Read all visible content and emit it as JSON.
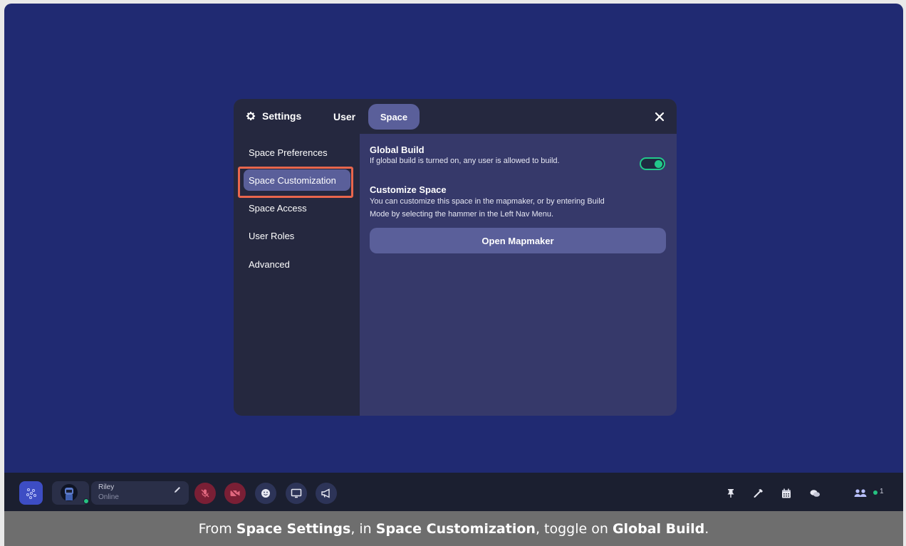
{
  "modal": {
    "title": "Settings",
    "tabs": [
      {
        "label": "User"
      },
      {
        "label": "Space"
      }
    ],
    "sidebar": [
      {
        "label": "Space Preferences"
      },
      {
        "label": "Space Customization"
      },
      {
        "label": "Space Access"
      },
      {
        "label": "User Roles"
      },
      {
        "label": "Advanced"
      }
    ],
    "global_build": {
      "title": "Global Build",
      "description": "If global build is turned on, any user is allowed to build.",
      "enabled": true
    },
    "customize": {
      "title": "Customize Space",
      "description_line1": "You can customize this space in the mapmaker, or by entering Build",
      "description_line2": "Mode by selecting the hammer in the Left Nav Menu.",
      "button_label": "Open Mapmaker"
    }
  },
  "bottombar": {
    "user_name": "Riley",
    "user_status": "Online",
    "participant_count": "1"
  },
  "caption": {
    "part1": "From ",
    "bold1": "Space Settings",
    "part2": ", in ",
    "bold2": "Space Customization",
    "part3": ", toggle on ",
    "bold3": "Global Build",
    "part4": "."
  },
  "colors": {
    "background": "#202a72",
    "accent": "#5a5f9a",
    "toggle_on": "#22c98a",
    "highlight": "#e8664d"
  }
}
